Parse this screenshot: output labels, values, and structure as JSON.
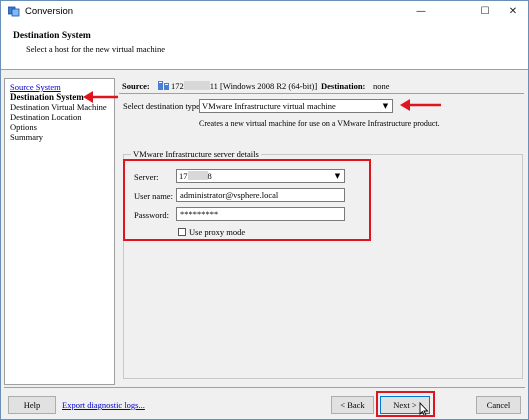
{
  "window": {
    "title": "Conversion",
    "minimize_glyph": "—",
    "maximize_glyph": "☐",
    "close_glyph": "✕"
  },
  "header": {
    "title": "Destination System",
    "subtitle": "Select a host for the new virtual machine"
  },
  "steps": [
    {
      "label": "Source System",
      "state": "link"
    },
    {
      "label": "Destination System",
      "state": "current"
    },
    {
      "label": "Destination Virtual Machine",
      "state": "normal"
    },
    {
      "label": "Destination Location",
      "state": "normal"
    },
    {
      "label": "Options",
      "state": "normal"
    },
    {
      "label": "Summary",
      "state": "normal"
    }
  ],
  "summary": {
    "source_label": "Source:",
    "source_prefix": "172",
    "source_suffix": "11 [Windows 2008 R2 (64-bit)]",
    "destination_label": "Destination:",
    "destination_value": "none"
  },
  "destination_type": {
    "label": "Select destination type:",
    "value": "VMware Infrastructure virtual machine",
    "description": "Creates a new virtual machine for use on a VMware Infrastructure product."
  },
  "server_details": {
    "group_title": "VMware Infrastructure server details",
    "server_label": "Server:",
    "server_prefix": "17",
    "server_suffix": "8",
    "username_label": "User name:",
    "username_value": "administrator@vsphere.local",
    "password_label": "Password:",
    "password_value": "*********",
    "proxy_label": "Use proxy mode",
    "proxy_checked": false
  },
  "footer": {
    "help_label": "Help",
    "export_link": "Export diagnostic logs...",
    "back_label": "< Back",
    "next_label": "Next >",
    "cancel_label": "Cancel"
  },
  "icons": {
    "app": "conversion-app-icon",
    "source_machine": "server-icon",
    "dropdown": "chevron-down-icon",
    "cursor": "mouse-pointer-icon",
    "annotation_arrow": "red-arrow-icon"
  },
  "colors": {
    "annotation": "#e0141e",
    "link": "#0000cc",
    "window_border": "#6a8fb6",
    "default_button_border": "#0078d7"
  }
}
